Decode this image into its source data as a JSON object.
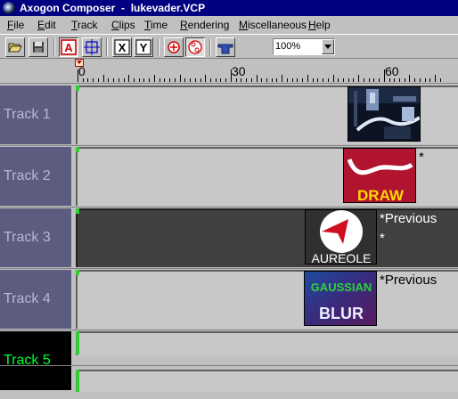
{
  "window": {
    "app_name": "Axogon Composer",
    "separator": "-",
    "file_name": "lukevader.VCP"
  },
  "menu": [
    {
      "label": "File",
      "mnemonic": "F"
    },
    {
      "label": "Edit",
      "mnemonic": "E"
    },
    {
      "label": "Track",
      "mnemonic": "T"
    },
    {
      "label": "Clips",
      "mnemonic": "C"
    },
    {
      "label": "Time",
      "mnemonic": "T"
    },
    {
      "label": "Rendering",
      "mnemonic": "R"
    },
    {
      "label": "Miscellaneous",
      "mnemonic": "M"
    },
    {
      "label": "Help",
      "mnemonic": "H"
    }
  ],
  "toolbar": {
    "buttons": [
      {
        "name": "open-icon"
      },
      {
        "name": "save-icon"
      },
      {
        "name": "text-tool-icon",
        "glyph": "A",
        "pressed": true
      },
      {
        "name": "grid-tool-icon"
      },
      {
        "name": "x-axis-icon",
        "glyph": "X"
      },
      {
        "name": "y-axis-icon",
        "glyph": "Y"
      },
      {
        "name": "crosshair-icon"
      },
      {
        "name": "nodes-icon"
      },
      {
        "name": "hat-icon"
      }
    ],
    "zoom_value": "100%"
  },
  "ruler": {
    "labels": [
      "0",
      "30",
      "60"
    ]
  },
  "tracks": [
    {
      "label": "Track 1",
      "active": false,
      "dark": false,
      "clips": [
        {
          "name": "starwars-scene-clip",
          "kind": "photo"
        }
      ],
      "notes": []
    },
    {
      "label": "Track 2",
      "active": false,
      "dark": false,
      "clips": [
        {
          "name": "draw-clip",
          "kind": "draw",
          "caption": "DRAW"
        }
      ],
      "notes": [
        "*"
      ]
    },
    {
      "label": "Track 3",
      "active": false,
      "dark": true,
      "clips": [
        {
          "name": "aureole-clip",
          "kind": "aureole",
          "caption": "AUREOLE"
        }
      ],
      "notes": [
        "*Previous",
        "*"
      ]
    },
    {
      "label": "Track 4",
      "active": false,
      "dark": false,
      "clips": [
        {
          "name": "gaussian-blur-clip",
          "kind": "blur",
          "caption_top": "GAUSSIAN",
          "caption_bottom": "BLUR"
        }
      ],
      "notes": [
        "*Previous"
      ]
    },
    {
      "label": "Track 5",
      "active": true,
      "dark": false,
      "clips": [],
      "notes": []
    }
  ],
  "colors": {
    "title_bar": "#000080",
    "track_label": "#5c5c80",
    "active_track_text": "#00ff33",
    "draw_clip": "#b0142e",
    "aureole_arrow": "#d01020"
  }
}
